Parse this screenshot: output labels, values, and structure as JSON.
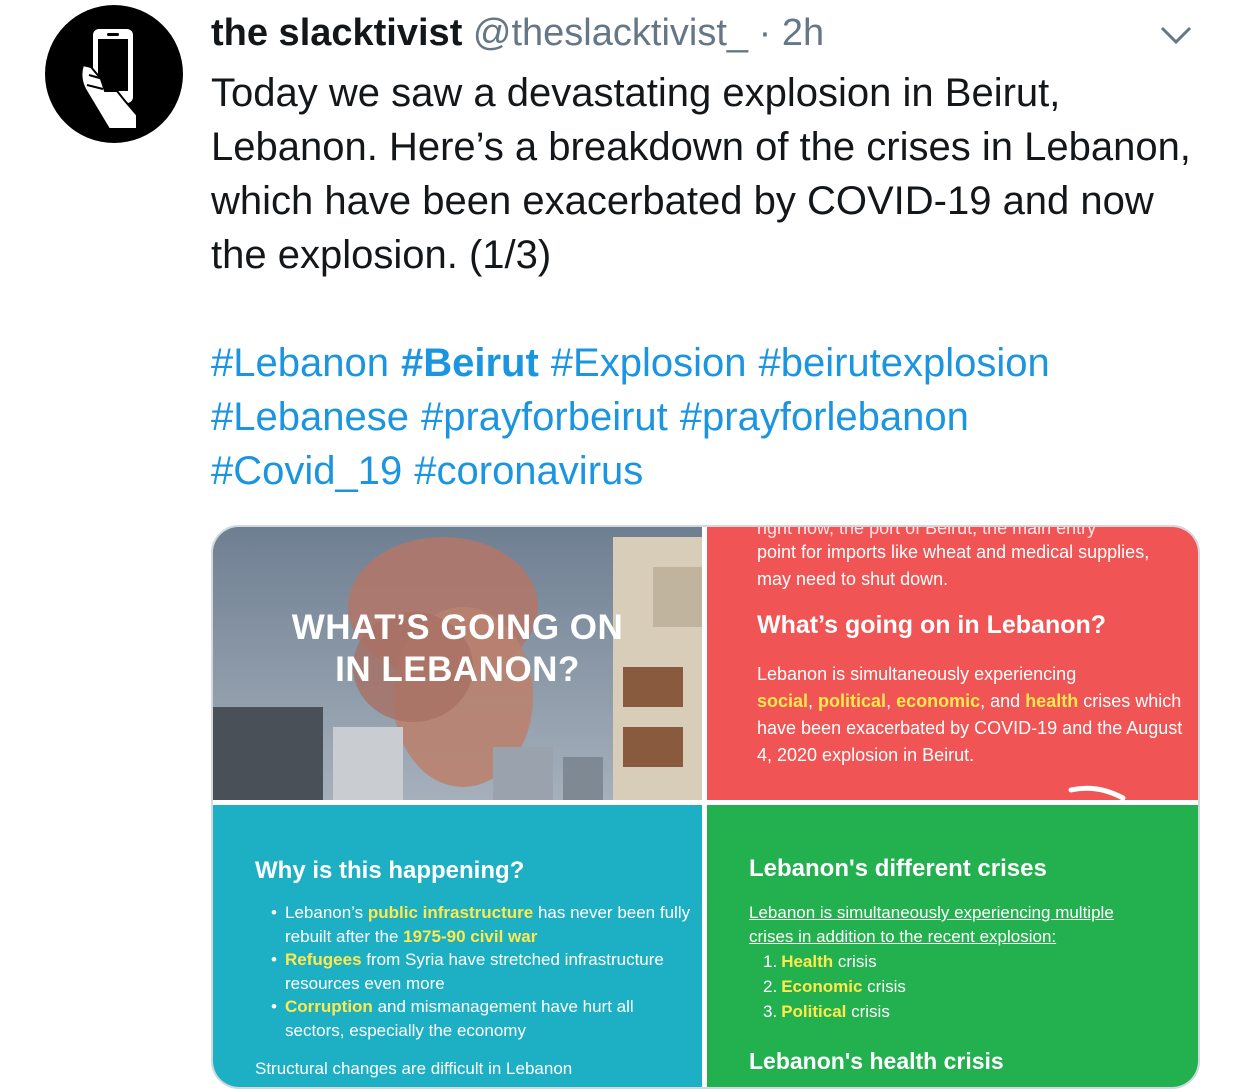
{
  "tweet": {
    "display_name": "the slacktivist",
    "handle": "@theslacktivist_",
    "separator": "·",
    "time": "2h",
    "text": "Today we saw a devastating explosion in Beirut, Lebanon. Here’s a breakdown of the crises in Lebanon, which have been exacerbated by COVID-19 and now the explosion. (1/3)",
    "hashtags": [
      "#Lebanon",
      "#Beirut",
      "#Explosion",
      "#beirutexplosion",
      "#Lebanese",
      "#prayforbeirut",
      "#prayforlebanon",
      "#Covid_19",
      "#coronavirus"
    ],
    "menu_icon": "chevron-down-icon",
    "avatar_icon": "hand-holding-phone-icon"
  },
  "media": {
    "tile1": {
      "title_line1": "WHAT’S GOING ON",
      "title_line2": "IN LEBANON?"
    },
    "tile2": {
      "cut_text": "right now, the port of Beirut, the main entry",
      "top_text": "point for imports like wheat and medical supplies, may need to shut down.",
      "heading": "What’s going on in Lebanon?",
      "body_before": "Lebanon is simultaneously experiencing",
      "hl_social": "social",
      "hl_political": "political",
      "hl_economic": "economic",
      "and": "and",
      "hl_health": "health",
      "body_after": "crises which have been exacerbated by COVID-19 and the August 4, 2020 explosion in Beirut."
    },
    "tile3": {
      "heading": "Why is this happening?",
      "b1_pre": "Lebanon’s",
      "b1_hl": "public infrastructure",
      "b1_mid": "has never been fully rebuilt after the",
      "b1_hl2": "1975-90 civil war",
      "b2_hl": "Refugees",
      "b2_rest": "from Syria have stretched infrastructure resources even more",
      "b3_hl": "Corruption",
      "b3_rest": "and mismanagement have hurt all sectors, especially the economy",
      "cut_text": "Structural changes are difficult in Lebanon"
    },
    "tile4": {
      "heading": "Lebanon's different crises",
      "intro": "Lebanon is simultaneously experiencing multiple crises in addition to the recent explosion:",
      "items": [
        {
          "num": "1.",
          "hl": "Health",
          "rest": "crisis"
        },
        {
          "num": "2.",
          "hl": "Economic",
          "rest": "crisis"
        },
        {
          "num": "3.",
          "hl": "Political",
          "rest": "crisis"
        }
      ],
      "subheading": "Lebanon's health crisis"
    }
  },
  "colors": {
    "link": "#1b95e0",
    "red_tile": "#f05454",
    "teal_tile": "#1db0c4",
    "green_tile": "#23b04f",
    "highlight": "#ffe94d"
  }
}
